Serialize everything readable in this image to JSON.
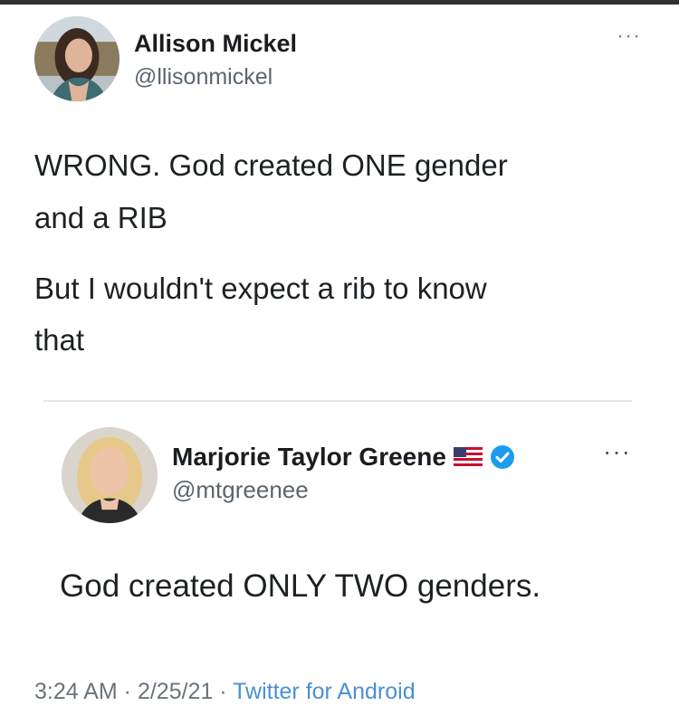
{
  "tweet": {
    "author": {
      "name": "Allison Mickel",
      "handle": "@llisonmickel"
    },
    "more_label": "···",
    "lines": [
      "WRONG. God created ONE gender",
      "and a RIB",
      "But I wouldn't expect a rib to know",
      "that"
    ],
    "timestamp": "3:24 AM · 2/25/21 · ",
    "source": "Twitter for Android"
  },
  "quoted": {
    "author": {
      "name": "Marjorie Taylor Greene",
      "handle": "@mtgreenee"
    },
    "more_label": "···",
    "text": "God created ONLY TWO genders."
  },
  "icons": {
    "flag": "us-flag-icon",
    "verified": "verified-badge-icon",
    "more": "more-options-icon"
  },
  "colors": {
    "link": "#4a90d2",
    "verified": "#1d9bf0",
    "secondary_text": "#5b6570"
  }
}
